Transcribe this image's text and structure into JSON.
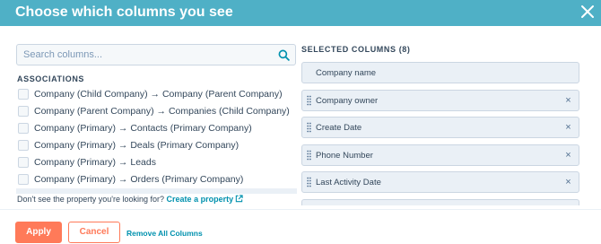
{
  "header": {
    "title": "Choose which columns you see",
    "close_icon": "close-icon"
  },
  "search": {
    "placeholder": "Search columns...",
    "value": "",
    "icon": "search-icon"
  },
  "associations": {
    "label": "ASSOCIATIONS",
    "options": [
      {
        "label": "Company (Child Company) → Company (Parent Company)",
        "checked": false
      },
      {
        "label": "Company (Parent Company) → Companies (Child Company)",
        "checked": false
      },
      {
        "label": "Company (Primary) → Contacts (Primary Company)",
        "checked": false
      },
      {
        "label": "Company (Primary) → Deals (Primary Company)",
        "checked": false
      },
      {
        "label": "Company (Primary) → Leads",
        "checked": false
      },
      {
        "label": "Company (Primary) → Orders (Primary Company)",
        "checked": false
      }
    ]
  },
  "hint": {
    "text": "Don't see the property you're looking for?",
    "link_label": "Create a property",
    "link_icon": "external-link-icon"
  },
  "selected": {
    "label": "SELECTED COLUMNS (8)",
    "items": [
      {
        "label": "Company name",
        "locked": true
      },
      {
        "label": "Company owner",
        "locked": false
      },
      {
        "label": "Create Date",
        "locked": false
      },
      {
        "label": "Phone Number",
        "locked": false
      },
      {
        "label": "Last Activity Date",
        "locked": false
      }
    ],
    "remove_glyph": "×",
    "drag_icon": "drag-handle-icon"
  },
  "footer": {
    "apply_label": "Apply",
    "cancel_label": "Cancel",
    "remove_all_label": "Remove All Columns"
  },
  "colors": {
    "header_bg": "#4fb0c6",
    "accent": "#ff7a59",
    "link": "#0091ae",
    "text": "#33475b",
    "chip_bg": "#eaf0f6",
    "border": "#cbd6e2"
  }
}
